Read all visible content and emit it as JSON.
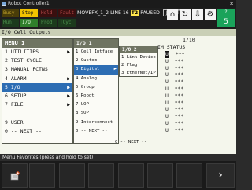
{
  "window": {
    "title": "Robot Controller1"
  },
  "status": {
    "leds": [
      {
        "label": "Busy",
        "color": "#4a3d08",
        "state": "off"
      },
      {
        "label": "Step",
        "color": "#f2c300",
        "state": "on"
      },
      {
        "label": "Hold",
        "color": "#3a0f0f",
        "state": "off"
      },
      {
        "label": "Fault",
        "color": "#3a0f0f",
        "state": "off"
      },
      {
        "label": "Run",
        "color": "#1c3a1c",
        "state": "off"
      },
      {
        "label": "I/O",
        "color": "#2f7f2b",
        "state": "on"
      },
      {
        "label": "Prod",
        "color": "#1c3a1c",
        "state": "off"
      },
      {
        "label": "TCyc",
        "color": "#1c3a1c",
        "state": "off"
      }
    ],
    "program": "MOVEFX_1_2 LINE 16",
    "badge": "T2",
    "state": "PAUSED",
    "coord": "JOINT",
    "help_label": "?",
    "help_number": "5",
    "icons": [
      "home-icon",
      "loop-icon",
      "download-icon",
      "gear-icon"
    ]
  },
  "frame": {
    "title": "I/O Cell Outputs",
    "page_count": "1/10",
    "column_headers": "IM STATUS",
    "rows": [
      {
        "cursor": "U",
        "status": "***"
      },
      {
        "cursor": "U",
        "status": "***"
      },
      {
        "cursor": "U",
        "status": "***"
      },
      {
        "cursor": "U",
        "status": "***"
      },
      {
        "cursor": "U",
        "status": "***"
      },
      {
        "cursor": "U",
        "status": "***"
      },
      {
        "cursor": "U",
        "status": "***"
      },
      {
        "cursor": "U",
        "status": "***"
      },
      {
        "cursor": "U",
        "status": "***"
      },
      {
        "cursor": "U",
        "status": "***"
      },
      {
        "cursor": "U",
        "status": "***"
      },
      {
        "cursor": "U",
        "status": "***"
      }
    ]
  },
  "menu1": {
    "header": "MENU 1",
    "items": [
      {
        "label": "1 UTILITIES",
        "submenu": true
      },
      {
        "label": "2 TEST CYCLE",
        "submenu": false
      },
      {
        "label": "3 MANUAL FCTNS",
        "submenu": false
      },
      {
        "label": "4 ALARM",
        "submenu": true
      },
      {
        "label": "5 I/O",
        "submenu": true,
        "selected": true
      },
      {
        "label": "6 SETUP",
        "submenu": true
      },
      {
        "label": "7 FILE",
        "submenu": true
      },
      {
        "label": "",
        "submenu": false
      },
      {
        "label": "9 USER",
        "submenu": false
      },
      {
        "label": "0 -- NEXT --",
        "submenu": false
      }
    ]
  },
  "menu2": {
    "header": "I/O 1",
    "items": [
      {
        "label": "1 Cell Intface",
        "submenu": false
      },
      {
        "label": "2 Custom",
        "submenu": false
      },
      {
        "label": "3 Digital",
        "submenu": true,
        "selected": true
      },
      {
        "label": "4 Analog",
        "submenu": false
      },
      {
        "label": "5 Group",
        "submenu": false
      },
      {
        "label": "6 Robot",
        "submenu": false
      },
      {
        "label": "7 UOP",
        "submenu": false
      },
      {
        "label": "8 SOP",
        "submenu": false
      },
      {
        "label": "9 Interconnect",
        "submenu": false
      },
      {
        "label": "0 -- NEXT --",
        "submenu": false
      }
    ]
  },
  "menu3": {
    "header": "I/O 2",
    "items": [
      "1 Link Device",
      "2 Flag",
      "3 EtherNet/IP"
    ],
    "next": "0 -- NEXT --"
  },
  "favorites": {
    "bar_text": "Menu Favorites (press and hold to set)"
  },
  "fkeys": {
    "next": "›"
  }
}
